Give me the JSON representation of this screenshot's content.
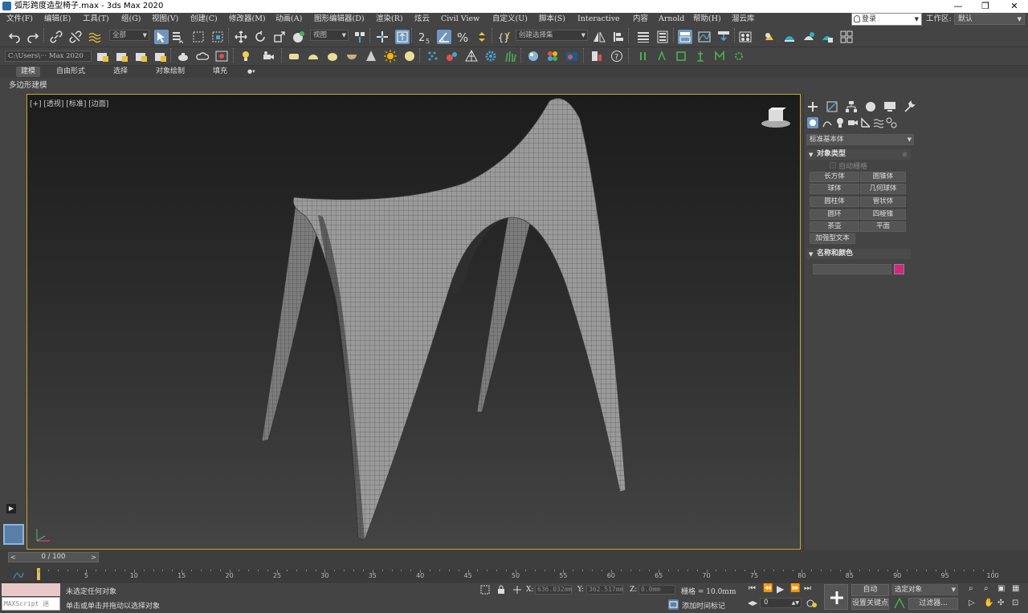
{
  "window": {
    "title": "弧形跨度造型椅子.max - 3ds Max 2020",
    "minimize": "—",
    "maximize": "❐",
    "close": "✕"
  },
  "menu": [
    "文件(F)",
    "编辑(E)",
    "工具(T)",
    "组(G)",
    "视图(V)",
    "创建(C)",
    "修改器(M)",
    "动画(A)",
    "图形编辑器(D)",
    "渲染(R)",
    "炫云",
    "Civil View",
    "自定义(U)",
    "脚本(S)",
    "Interactive",
    "内容",
    "Arnold",
    "帮助(H)",
    "溜云库"
  ],
  "login": "登录",
  "workspace": {
    "label": "工作区:",
    "value": "默认"
  },
  "toolbar": {
    "filter": "全部",
    "ref_coord": "视图",
    "selection_set": "创建选择集",
    "path": "C:\\Users\\··· Max 2020"
  },
  "ribbon": {
    "tabs": [
      "建模",
      "自由形式",
      "选择",
      "对象绘制",
      "填充"
    ],
    "active": "建模",
    "sub": "多边形建模"
  },
  "viewport": {
    "label": "[+] [透视] [标准] [边面]"
  },
  "command_panel": {
    "category": "标准基本体",
    "object_type": {
      "header": "对象类型",
      "autogrid": "自动栅格",
      "buttons": [
        "长方体",
        "圆锥体",
        "球体",
        "几何球体",
        "圆柱体",
        "管状体",
        "圆环",
        "四棱锥",
        "茶壶",
        "平面"
      ],
      "extra": "加强型文本"
    },
    "name_color": {
      "header": "名称和颜色",
      "color": "#d4287c"
    }
  },
  "timeline": {
    "frame_display": "0 / 100",
    "ticks": [
      "0",
      "5",
      "10",
      "15",
      "20",
      "25",
      "30",
      "35",
      "40",
      "45",
      "50",
      "55",
      "60",
      "65",
      "70",
      "75",
      "80",
      "85",
      "90",
      "95",
      "100"
    ]
  },
  "status": {
    "maxscript": "MAXScript 迷",
    "selection": "未选定任何对象",
    "hint": "单击或单击并拖动以选择对象",
    "x_label": "X:",
    "x_value": "636.032mm",
    "y_label": "Y:",
    "y_value": "362.517mm",
    "z_label": "Z:",
    "z_value": "0.0mm",
    "grid": "栅格 = 10.0mm",
    "add_time_tag": "添加时间标记",
    "auto": "自动",
    "selected_object": "选定对象",
    "set_key": "设置关键点",
    "filters": "过滤器...",
    "frame": "0"
  }
}
